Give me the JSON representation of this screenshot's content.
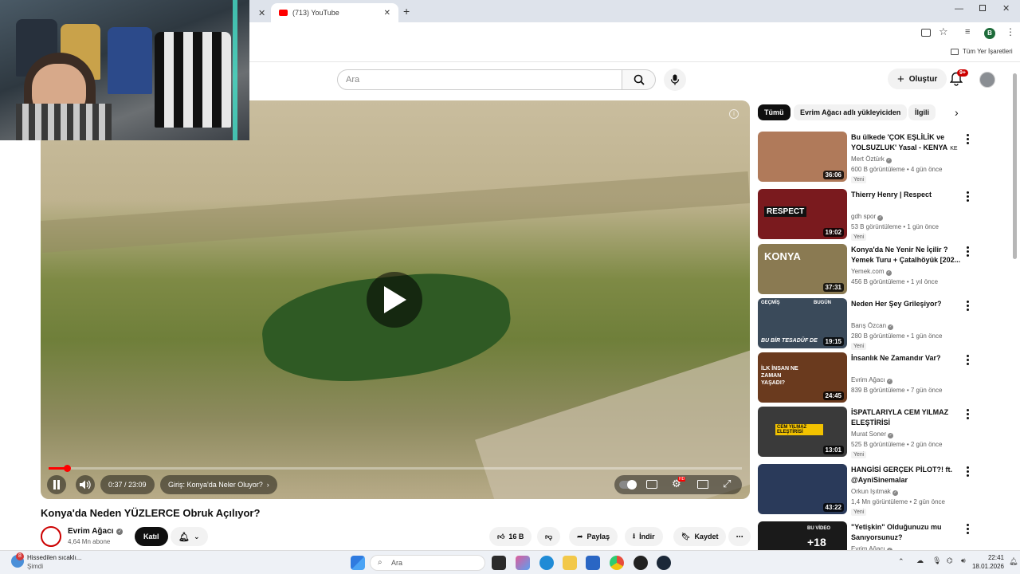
{
  "browser": {
    "tab_title": "(713) YouTube",
    "bookmarks_label": "Tüm Yer İşaretleri",
    "profile_initial": "B"
  },
  "header": {
    "search_placeholder": "Ara",
    "create_label": "Oluştur",
    "notif_count": "9+"
  },
  "video": {
    "time": "0:37 / 23:09",
    "chapter": "Giriş: Konya'da Neler Oluyor?",
    "progress": 0.027,
    "title": "Konya'da Neden YÜZLERCE Obruk Açılıyor?",
    "channel": "Evrim Ağacı",
    "subscribers": "4,64 Mn abone",
    "join_label": "Katıl",
    "likes": "16 B",
    "share_label": "Paylaş",
    "download_label": "İndir",
    "save_label": "Kaydet",
    "hd_badge": "HD"
  },
  "filters": [
    "Tümü",
    "Evrim Ağacı adlı yükleyiciden",
    "İlgili"
  ],
  "recommendations": [
    {
      "title": "Bu ülkede 'ÇOK EŞLİLİK ve YOLSUZLUK' Yasal - KENYA",
      "title_suffix": "KE",
      "channel": "Mert Öztürk",
      "meta": "600 B görüntüleme • 4 gün önce",
      "badge": "Yeni",
      "duration": "36:06",
      "thumb_color": "#b07a5a"
    },
    {
      "title": "Thierry Henry | Respect",
      "title_suffix": "",
      "channel": "gdh spor",
      "meta": "53 B görüntüleme • 1 gün önce",
      "badge": "Yeni",
      "duration": "19:02",
      "thumb_color": "#7a1a1e"
    },
    {
      "title": "Konya'da Ne Yenir Ne İçilir ? Yemek Turu + Çatalhöyük [202...",
      "title_suffix": "",
      "channel": "Yemek.com",
      "meta": "456 B görüntüleme • 1 yıl önce",
      "badge": "",
      "duration": "37:31",
      "thumb_color": "#8a7a52"
    },
    {
      "title": "Neden Her Şey Grileşiyor?",
      "title_suffix": "",
      "channel": "Barış Özcan",
      "meta": "280 B görüntüleme • 1 gün önce",
      "badge": "Yeni",
      "duration": "19:15",
      "thumb_color": "#3a4a5a"
    },
    {
      "title": "İnsanlık Ne Zamandır Var?",
      "title_suffix": "",
      "channel": "Evrim Ağacı",
      "meta": "839 B görüntüleme • 7 gün önce",
      "badge": "",
      "duration": "24:45",
      "thumb_color": "#6a3a1e"
    },
    {
      "title": "İSPATLARIYLA CEM YILMAZ ELEŞTİRİSİ",
      "title_suffix": "",
      "channel": "Murat Soner",
      "meta": "525 B görüntüleme • 2 gün önce",
      "badge": "Yeni",
      "duration": "13:01",
      "thumb_color": "#3a3a3a"
    },
    {
      "title": "HANGİSİ GERÇEK PİLOT?! ft. @AyniSinemalar",
      "title_suffix": "",
      "channel": "Orkun Işıtmak",
      "meta": "1,4 Mn görüntüleme • 2 gün önce",
      "badge": "Yeni",
      "duration": "43:22",
      "thumb_color": "#2a3a5a"
    },
    {
      "title": "\"Yetişkin\" Olduğunuzu mu Sanıyorsunuz?",
      "title_suffix": "",
      "channel": "Evrim Ağacı",
      "meta": "",
      "badge": "",
      "duration": "",
      "thumb_color": "#1a1a1a"
    }
  ],
  "thumb_overlays": {
    "respect": "RESPECT",
    "konya": "KONYA",
    "gecmis": "GEÇMİŞ",
    "bugun": "BUGÜN",
    "tesaduf": "BU BİR TESADÜF DE",
    "ilk_insan": "İLK İNSAN NE ZAMAN YAŞADI?",
    "cem": "CEM YILMAZ ELEŞTİRİSİ",
    "bu_video": "BU VİDEO",
    "plus18": "+18"
  },
  "taskbar": {
    "notif_badge": "8",
    "weather_title": "Hissedilen sıcaklı...",
    "weather_sub": "Şimdi",
    "search_label": "Ara",
    "time": "22:41",
    "date": "18.01.2026"
  }
}
